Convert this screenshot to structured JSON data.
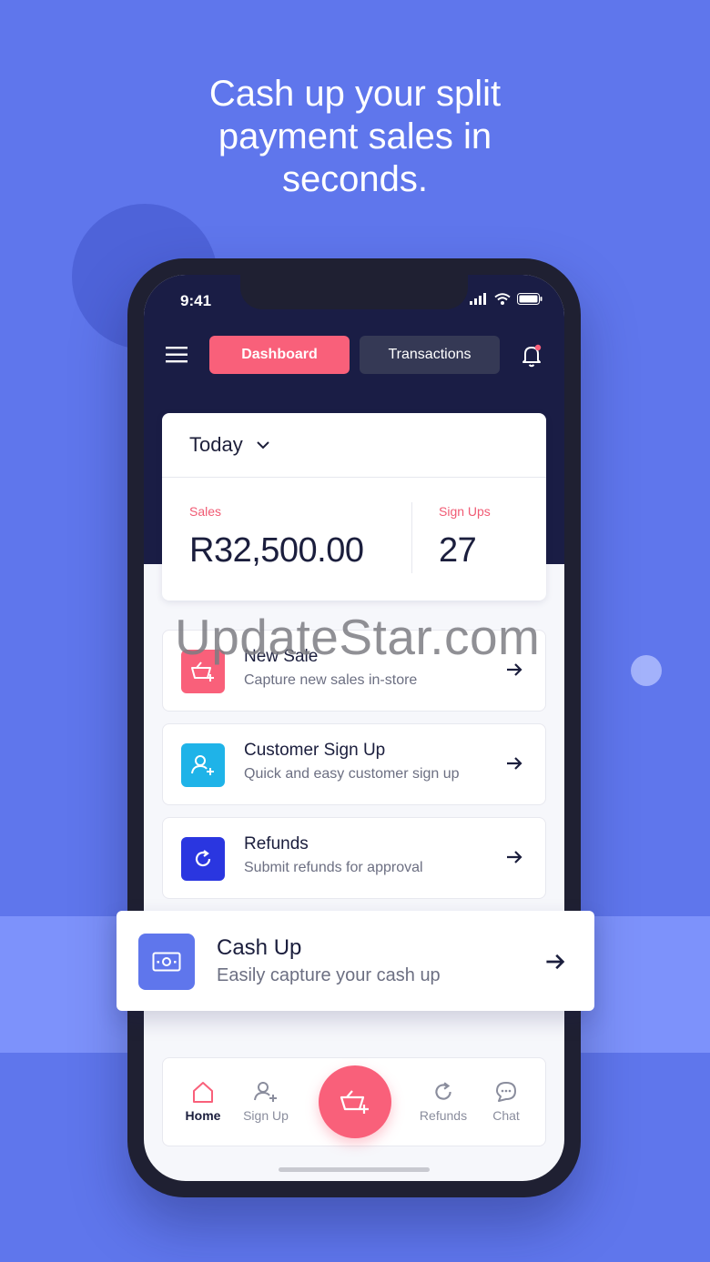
{
  "headline": "Cash up your split payment sales in seconds.",
  "status_bar": {
    "time": "9:41"
  },
  "header": {
    "menu_icon": "hamburger-icon",
    "tabs": [
      {
        "label": "Dashboard",
        "active": true
      },
      {
        "label": "Transactions",
        "active": false
      }
    ],
    "notification_icon": "bell-icon"
  },
  "stats": {
    "period": "Today",
    "sales_label": "Sales",
    "sales_value": "R32,500.00",
    "signups_label": "Sign Ups",
    "signups_value": "27"
  },
  "actions": [
    {
      "title": "New Sale",
      "subtitle": "Capture new sales in-store",
      "icon": "basket-plus-icon",
      "color": "#f9607a"
    },
    {
      "title": "Customer Sign Up",
      "subtitle": "Quick and easy customer sign up",
      "icon": "user-plus-icon",
      "color": "#1fb3e8"
    },
    {
      "title": "Refunds",
      "subtitle": "Submit refunds for approval",
      "icon": "refresh-icon",
      "color": "#2a36e0"
    }
  ],
  "cashup": {
    "title": "Cash Up",
    "subtitle": "Easily capture your cash up",
    "icon": "cash-icon",
    "color": "#5f76ec"
  },
  "bottom_nav": [
    {
      "label": "Home",
      "icon": "home-icon",
      "active": true
    },
    {
      "label": "Sign Up",
      "icon": "user-plus-icon",
      "active": false
    },
    {
      "label": "Refunds",
      "icon": "refresh-icon",
      "active": false
    },
    {
      "label": "Chat",
      "icon": "chat-icon",
      "active": false
    }
  ],
  "watermark": "UpdateStar.com",
  "colors": {
    "background": "#5f76ec",
    "accent": "#f9607a",
    "dark": "#1a1d45"
  }
}
